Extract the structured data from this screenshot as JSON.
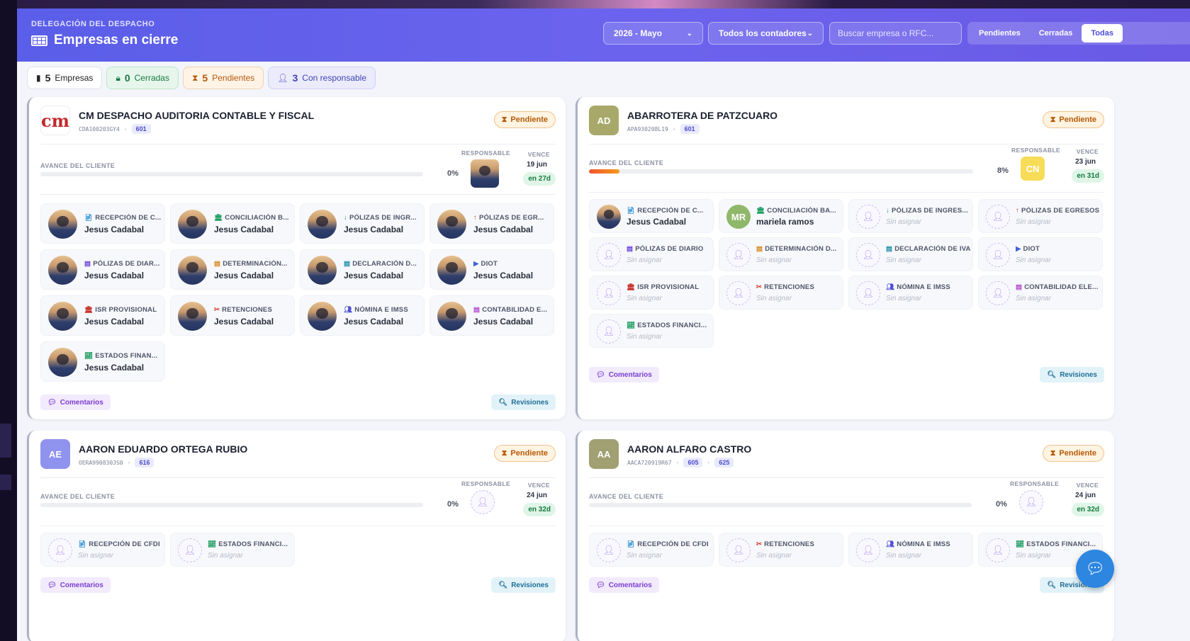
{
  "header": {
    "kicker": "DELEGACIÓN DEL DESPACHO",
    "title": "Empresas en cierre",
    "period": "2026 - Mayo",
    "accountants": "Todos los contadores",
    "search_placeholder": "Buscar empresa o RFC...",
    "filters": [
      "Pendientes",
      "Cerradas",
      "Todas"
    ],
    "active_filter": "Todas"
  },
  "summary": {
    "empresas_count": "5",
    "empresas_label": "Empresas",
    "cerradas_count": "0",
    "cerradas_label": "Cerradas",
    "pendientes_count": "5",
    "pendientes_label": "Pendientes",
    "resp_count": "3",
    "resp_label": "Con responsable"
  },
  "labels": {
    "avance": "AVANCE DEL CLIENTE",
    "responsable": "RESPONSABLE",
    "vence": "VENCE",
    "pendiente": "Pendiente",
    "comentarios": "Comentarios",
    "revisiones": "Revisiones",
    "sin_asignar": "Sin asignar"
  },
  "cards": [
    {
      "name": "CM DESPACHO AUDITORIA CONTABLE Y FISCAL",
      "rfc": "CDA100203GY4",
      "regimes": [
        "601"
      ],
      "initials": "",
      "logo_text": "cm",
      "progress_pct": "0%",
      "progress": 0,
      "due": "19 jun",
      "due_in": "en 27d",
      "tasks": [
        {
          "label": "RECEPCIÓN DE C...",
          "assignee": "Jesus Cadabal"
        },
        {
          "label": "CONCILIACIÓN B...",
          "assignee": "Jesus Cadabal"
        },
        {
          "label": "PÓLIZAS DE INGR...",
          "assignee": "Jesus Cadabal"
        },
        {
          "label": "PÓLIZAS DE EGR...",
          "assignee": "Jesus Cadabal"
        },
        {
          "label": "PÓLIZAS DE DIAR...",
          "assignee": "Jesus Cadabal"
        },
        {
          "label": "DETERMINACIÓN...",
          "assignee": "Jesus Cadabal"
        },
        {
          "label": "DECLARACIÓN D...",
          "assignee": "Jesus Cadabal"
        },
        {
          "label": "DIOT",
          "assignee": "Jesus Cadabal"
        },
        {
          "label": "ISR PROVISIONAL",
          "assignee": "Jesus Cadabal"
        },
        {
          "label": "RETENCIONES",
          "assignee": "Jesus Cadabal"
        },
        {
          "label": "NÓMINA E IMSS",
          "assignee": "Jesus Cadabal"
        },
        {
          "label": "CONTABILIDAD E...",
          "assignee": "Jesus Cadabal"
        },
        {
          "label": "ESTADOS FINAN...",
          "assignee": "Jesus Cadabal"
        }
      ]
    },
    {
      "name": "ABARROTERA DE PATZCUARO",
      "rfc": "APA930208L19",
      "regimes": [
        "601"
      ],
      "initials": "AD",
      "progress_pct": "8%",
      "progress": 8,
      "resp_initials": "CN",
      "due": "23 jun",
      "due_in": "en 31d",
      "tasks": [
        {
          "label": "RECEPCIÓN DE C...",
          "assignee": "Jesus Cadabal"
        },
        {
          "label": "CONCILIACIÓN BA...",
          "assignee": "mariela ramos",
          "initials": "MR"
        },
        {
          "label": "PÓLIZAS DE INGRES...",
          "assignee": ""
        },
        {
          "label": "PÓLIZAS DE EGRESOS",
          "assignee": ""
        },
        {
          "label": "PÓLIZAS DE DIARIO",
          "assignee": ""
        },
        {
          "label": "DETERMINACIÓN D...",
          "assignee": ""
        },
        {
          "label": "DECLARACIÓN DE IVA",
          "assignee": ""
        },
        {
          "label": "DIOT",
          "assignee": ""
        },
        {
          "label": "ISR PROVISIONAL",
          "assignee": ""
        },
        {
          "label": "RETENCIONES",
          "assignee": ""
        },
        {
          "label": "NÓMINA E IMSS",
          "assignee": ""
        },
        {
          "label": "CONTABILIDAD ELE...",
          "assignee": ""
        },
        {
          "label": "ESTADOS FINANCI...",
          "assignee": ""
        }
      ]
    },
    {
      "name": "AARON EDUARDO ORTEGA RUBIO",
      "rfc": "OERA990830JS0",
      "regimes": [
        "616"
      ],
      "initials": "AE",
      "progress_pct": "0%",
      "progress": 0,
      "due": "24 jun",
      "due_in": "en 32d",
      "tasks": [
        {
          "label": "RECEPCIÓN DE CFDI",
          "assignee": ""
        },
        {
          "label": "ESTADOS FINANCI...",
          "assignee": ""
        }
      ]
    },
    {
      "name": "AARON ALFARO CASTRO",
      "rfc": "AACA720919R67",
      "regimes": [
        "605",
        "625"
      ],
      "initials": "AA",
      "progress_pct": "0%",
      "progress": 0,
      "due": "24 jun",
      "due_in": "en 32d",
      "tasks": [
        {
          "label": "RECEPCIÓN DE CFDI",
          "assignee": ""
        },
        {
          "label": "RETENCIONES",
          "assignee": ""
        },
        {
          "label": "NÓMINA E IMSS",
          "assignee": ""
        },
        {
          "label": "ESTADOS FINANCI...",
          "assignee": ""
        }
      ]
    }
  ],
  "colors": {
    "header": "#5a5ee8",
    "pending": "#b65a06",
    "closed": "#177a3e",
    "progress": "#f2542a"
  }
}
